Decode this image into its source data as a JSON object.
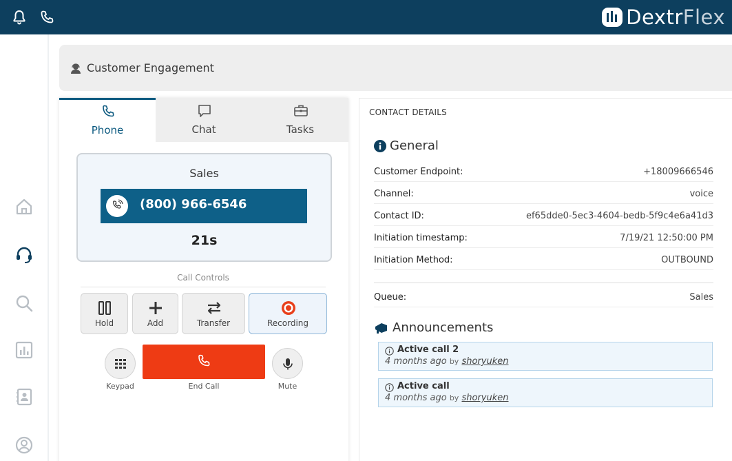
{
  "topbar": {
    "brand_main": "Dextr",
    "brand_accent": "Flex",
    "icons": [
      "bell-icon",
      "phone-icon"
    ]
  },
  "sidebar": {
    "items": [
      {
        "name": "home",
        "icon": "home-icon"
      },
      {
        "name": "engagement",
        "icon": "headset-icon",
        "active": true
      },
      {
        "name": "search",
        "icon": "search-icon"
      },
      {
        "name": "reports",
        "icon": "bar-chart-icon"
      },
      {
        "name": "contacts",
        "icon": "address-book-icon"
      },
      {
        "name": "profile",
        "icon": "user-circle-icon"
      }
    ]
  },
  "header": {
    "title": "Customer Engagement"
  },
  "tabs": [
    {
      "label": "Phone",
      "active": true
    },
    {
      "label": "Chat",
      "active": false
    },
    {
      "label": "Tasks",
      "active": false
    }
  ],
  "call": {
    "queue": "Sales",
    "number": "(800) 966-6546",
    "timer": "21s"
  },
  "controls": {
    "label": "Call Controls",
    "hold": "Hold",
    "add": "Add",
    "transfer": "Transfer",
    "recording": "Recording",
    "keypad": "Keypad",
    "end_call": "End Call",
    "mute": "Mute"
  },
  "contact": {
    "title": "CONTACT DETAILS",
    "general_heading": "General",
    "fields": [
      {
        "key": "Customer Endpoint:",
        "value": "+18009666546"
      },
      {
        "key": "Channel:",
        "value": "voice"
      },
      {
        "key": "Contact ID:",
        "value": "ef65dde0-5ec3-4604-bedb-5f9c4e6a41d3"
      },
      {
        "key": "Initiation timestamp:",
        "value": "7/19/21 12:50:00 PM"
      },
      {
        "key": "Initiation Method:",
        "value": "OUTBOUND"
      }
    ],
    "queue_key": "Queue:",
    "queue_value": "Sales",
    "announcements_heading": "Announcements",
    "announcements": [
      {
        "title": "Active call 2",
        "ago": "4 months ago",
        "by": "by",
        "user": "shoryuken"
      },
      {
        "title": "Active call",
        "ago": "4 months ago",
        "by": "by",
        "user": "shoryuken"
      }
    ]
  },
  "colors": {
    "topbar": "#0d3f5e",
    "accent": "#0e6088",
    "end_call": "#ee3b14",
    "record_dot": "#e8401c"
  }
}
